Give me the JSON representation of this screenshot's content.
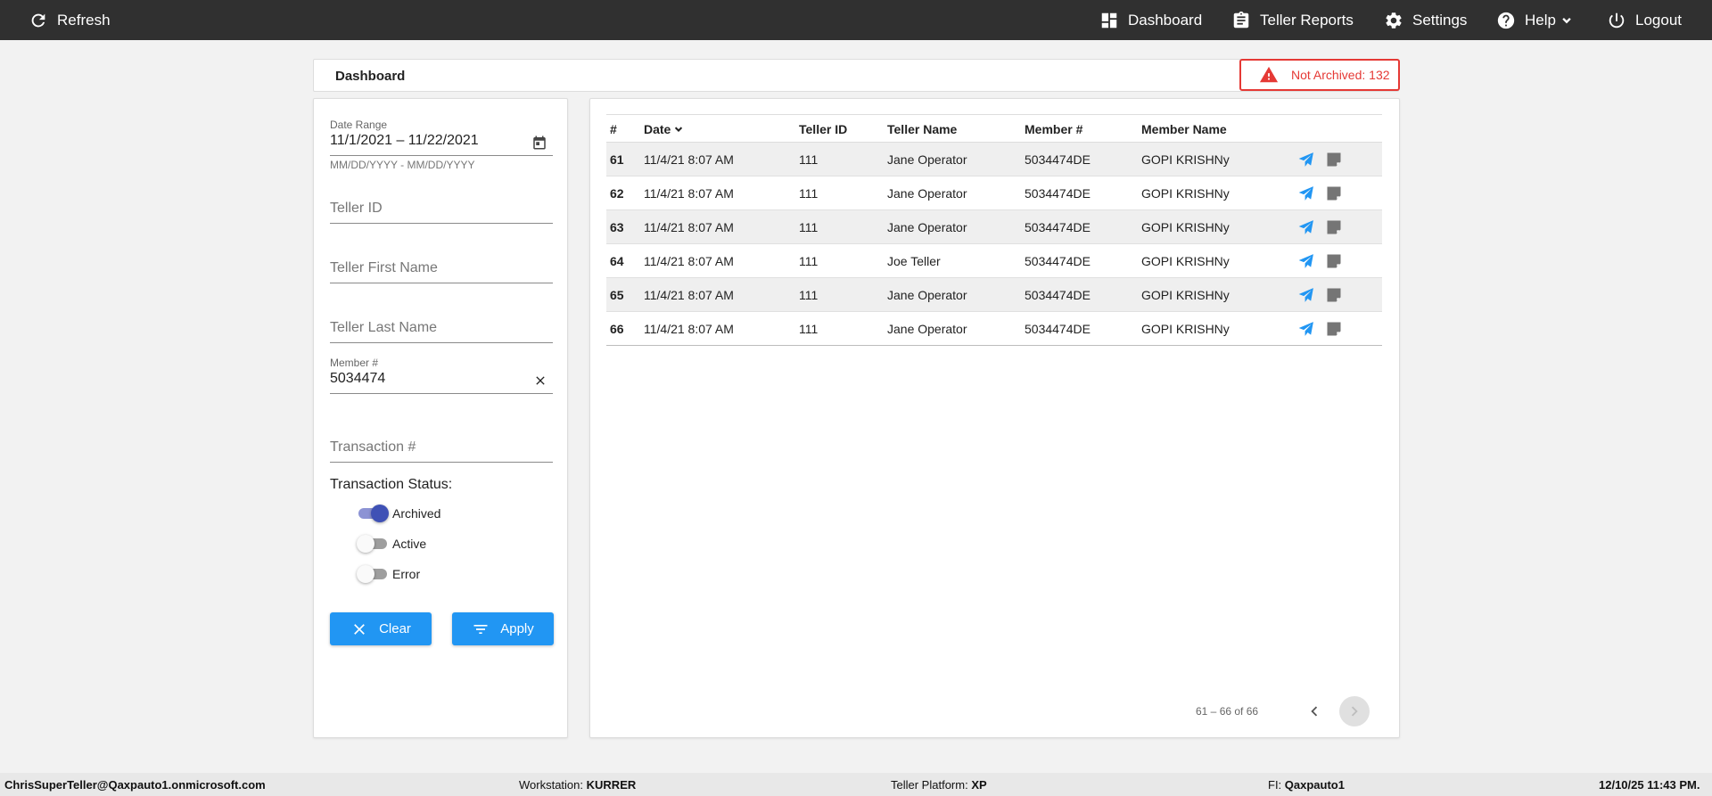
{
  "topbar": {
    "refresh_label": "Refresh",
    "dashboard_label": "Dashboard",
    "teller_reports_label": "Teller Reports",
    "settings_label": "Settings",
    "help_label": "Help",
    "logout_label": "Logout"
  },
  "header": {
    "title": "Dashboard",
    "alert_text": "Not Archived: 132",
    "alert_color": "#e53935"
  },
  "filters": {
    "date_range_label": "Date Range",
    "date_range_value": "11/1/2021 – 11/22/2021",
    "date_range_hint": "MM/DD/YYYY - MM/DD/YYYY",
    "teller_id_placeholder": "Teller ID",
    "teller_first_name_placeholder": "Teller First Name",
    "teller_last_name_placeholder": "Teller Last Name",
    "member_label": "Member #",
    "member_value": "5034474",
    "transaction_placeholder": "Transaction #",
    "status_label": "Transaction Status:",
    "statuses": [
      {
        "label": "Archived",
        "on": true
      },
      {
        "label": "Active",
        "on": false
      },
      {
        "label": "Error",
        "on": false
      }
    ],
    "clear_label": "Clear",
    "apply_label": "Apply",
    "accent_color": "#2196f3"
  },
  "table": {
    "columns": [
      "#",
      "Date",
      "Teller ID",
      "Teller Name",
      "Member #",
      "Member Name"
    ],
    "sort_column": "Date",
    "rows": [
      {
        "num": "61",
        "date": "11/4/21 8:07 AM",
        "teller_id": "111",
        "teller_name": "Jane Operator",
        "member": "5034474DE",
        "member_name": "GOPI KRISHNy"
      },
      {
        "num": "62",
        "date": "11/4/21 8:07 AM",
        "teller_id": "111",
        "teller_name": "Jane Operator",
        "member": "5034474DE",
        "member_name": "GOPI KRISHNy"
      },
      {
        "num": "63",
        "date": "11/4/21 8:07 AM",
        "teller_id": "111",
        "teller_name": "Jane Operator",
        "member": "5034474DE",
        "member_name": "GOPI KRISHNy"
      },
      {
        "num": "64",
        "date": "11/4/21 8:07 AM",
        "teller_id": "111",
        "teller_name": "Joe Teller",
        "member": "5034474DE",
        "member_name": "GOPI KRISHNy"
      },
      {
        "num": "65",
        "date": "11/4/21 8:07 AM",
        "teller_id": "111",
        "teller_name": "Jane Operator",
        "member": "5034474DE",
        "member_name": "GOPI KRISHNy"
      },
      {
        "num": "66",
        "date": "11/4/21 8:07 AM",
        "teller_id": "111",
        "teller_name": "Jane Operator",
        "member": "5034474DE",
        "member_name": "GOPI KRISHNy"
      }
    ],
    "pager_text": "61 – 66 of 66"
  },
  "footer": {
    "user": "ChrisSuperTeller@Qaxpauto1.onmicrosoft.com",
    "workstation_label": "Workstation:",
    "workstation_value": "KURRER",
    "platform_label": "Teller Platform:",
    "platform_value": "XP",
    "fi_label": "FI:",
    "fi_value": "Qaxpauto1",
    "datetime": "12/10/25 11:43 PM."
  }
}
